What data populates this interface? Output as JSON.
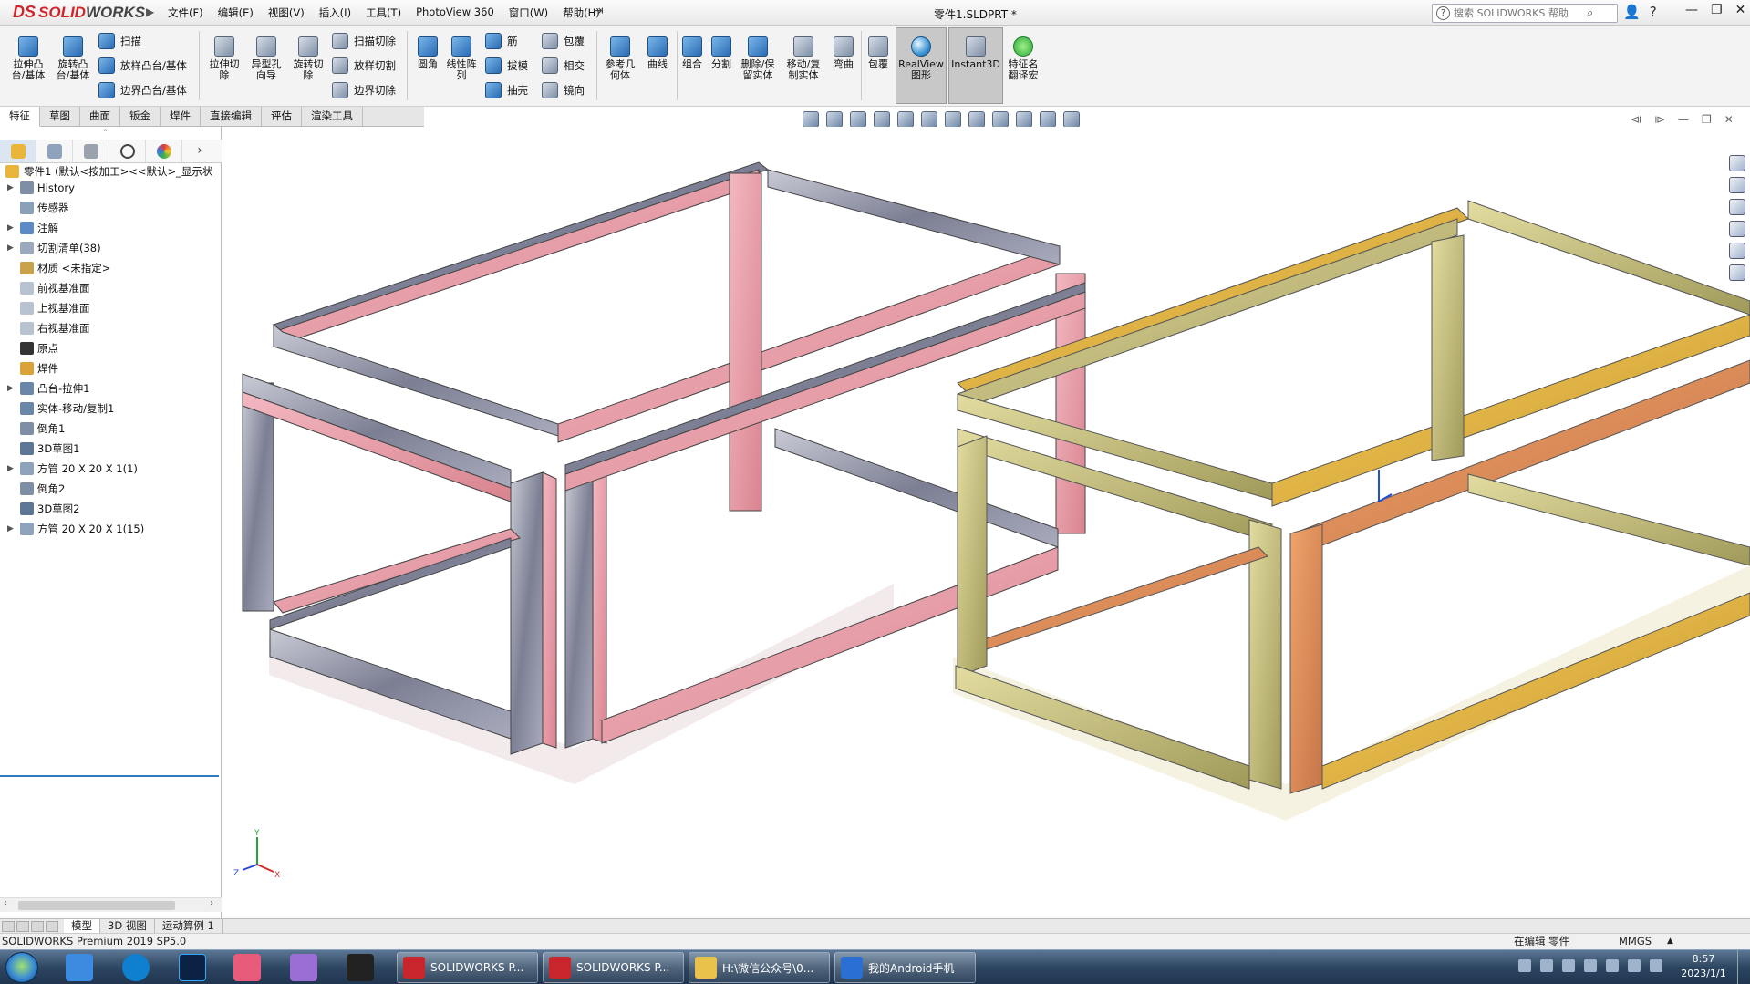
{
  "app": {
    "logo_prefix": "DS",
    "logo_solid": "SOLID",
    "logo_works": "WORKS",
    "document_title": "零件1.SLDPRT *"
  },
  "menu": [
    "文件(F)",
    "编辑(E)",
    "视图(V)",
    "插入(I)",
    "工具(T)",
    "PhotoView 360",
    "窗口(W)",
    "帮助(H)"
  ],
  "search": {
    "placeholder": "搜索 SOLIDWORKS 帮助"
  },
  "toolbar": {
    "extrude_boss": "拉伸凸\n台/基体",
    "revolve_boss": "旋转凸\n台/基体",
    "sweep": "扫描",
    "loft_boss": "放样凸台/基体",
    "boundary_boss": "边界凸台/基体",
    "extrude_cut": "拉伸切\n除",
    "hole_wizard": "异型孔\n向导",
    "revolve_cut": "旋转切\n除",
    "sweep_cut": "扫描切除",
    "loft_cut": "放样切割",
    "boundary_cut": "边界切除",
    "fillet": "圆角",
    "linear_pattern": "线性阵\n列",
    "rib": "筋",
    "draft": "拔模",
    "shell": "抽壳",
    "wrap": "包覆",
    "intersect": "相交",
    "mirror": "镜向",
    "ref_geometry": "参考几\n何体",
    "curves": "曲线",
    "combine": "组合",
    "split": "分割",
    "delete_keep_body": "删除/保\n留实体",
    "move_copy_body": "移动/复\n制实体",
    "flex": "弯曲",
    "wrap2": "包覆",
    "realview": "RealView\n图形",
    "instant3d": "Instant3D",
    "feature_translate": "特征名\n翻译宏"
  },
  "tabs": [
    "特征",
    "草图",
    "曲面",
    "钣金",
    "焊件",
    "直接编辑",
    "评估",
    "渲染工具"
  ],
  "feature_tree": {
    "root": "零件1 (默认<按加工><<默认>_显示状",
    "items": [
      "History",
      "传感器",
      "注解",
      "切割清单(38)",
      "材质 <未指定>",
      "前视基准面",
      "上视基准面",
      "右视基准面",
      "原点",
      "焊件",
      "凸台-拉伸1",
      "实体-移动/复制1",
      "倒角1",
      "3D草图1",
      "方管 20 X 20 X 1(1)",
      "倒角2",
      "3D草图2",
      "方管 20 X 20 X 1(15)"
    ]
  },
  "bottom_tabs": [
    "模型",
    "3D 视图",
    "运动算例 1"
  ],
  "status": {
    "product": "SOLIDWORKS Premium 2019 SP5.0",
    "mode": "在编辑 零件",
    "units": "MMGS"
  },
  "taskbar": {
    "buttons": [
      "SOLIDWORKS P...",
      "SOLIDWORKS P...",
      "H:\\微信公众号\\0...",
      "我的Android手机"
    ],
    "time": "8:57",
    "date": "2023/1/1"
  },
  "triad": {
    "x": "X",
    "y": "Y",
    "z": "Z"
  },
  "colors": {
    "accent": "#2d7bc4",
    "logo_red": "#d2232a"
  }
}
